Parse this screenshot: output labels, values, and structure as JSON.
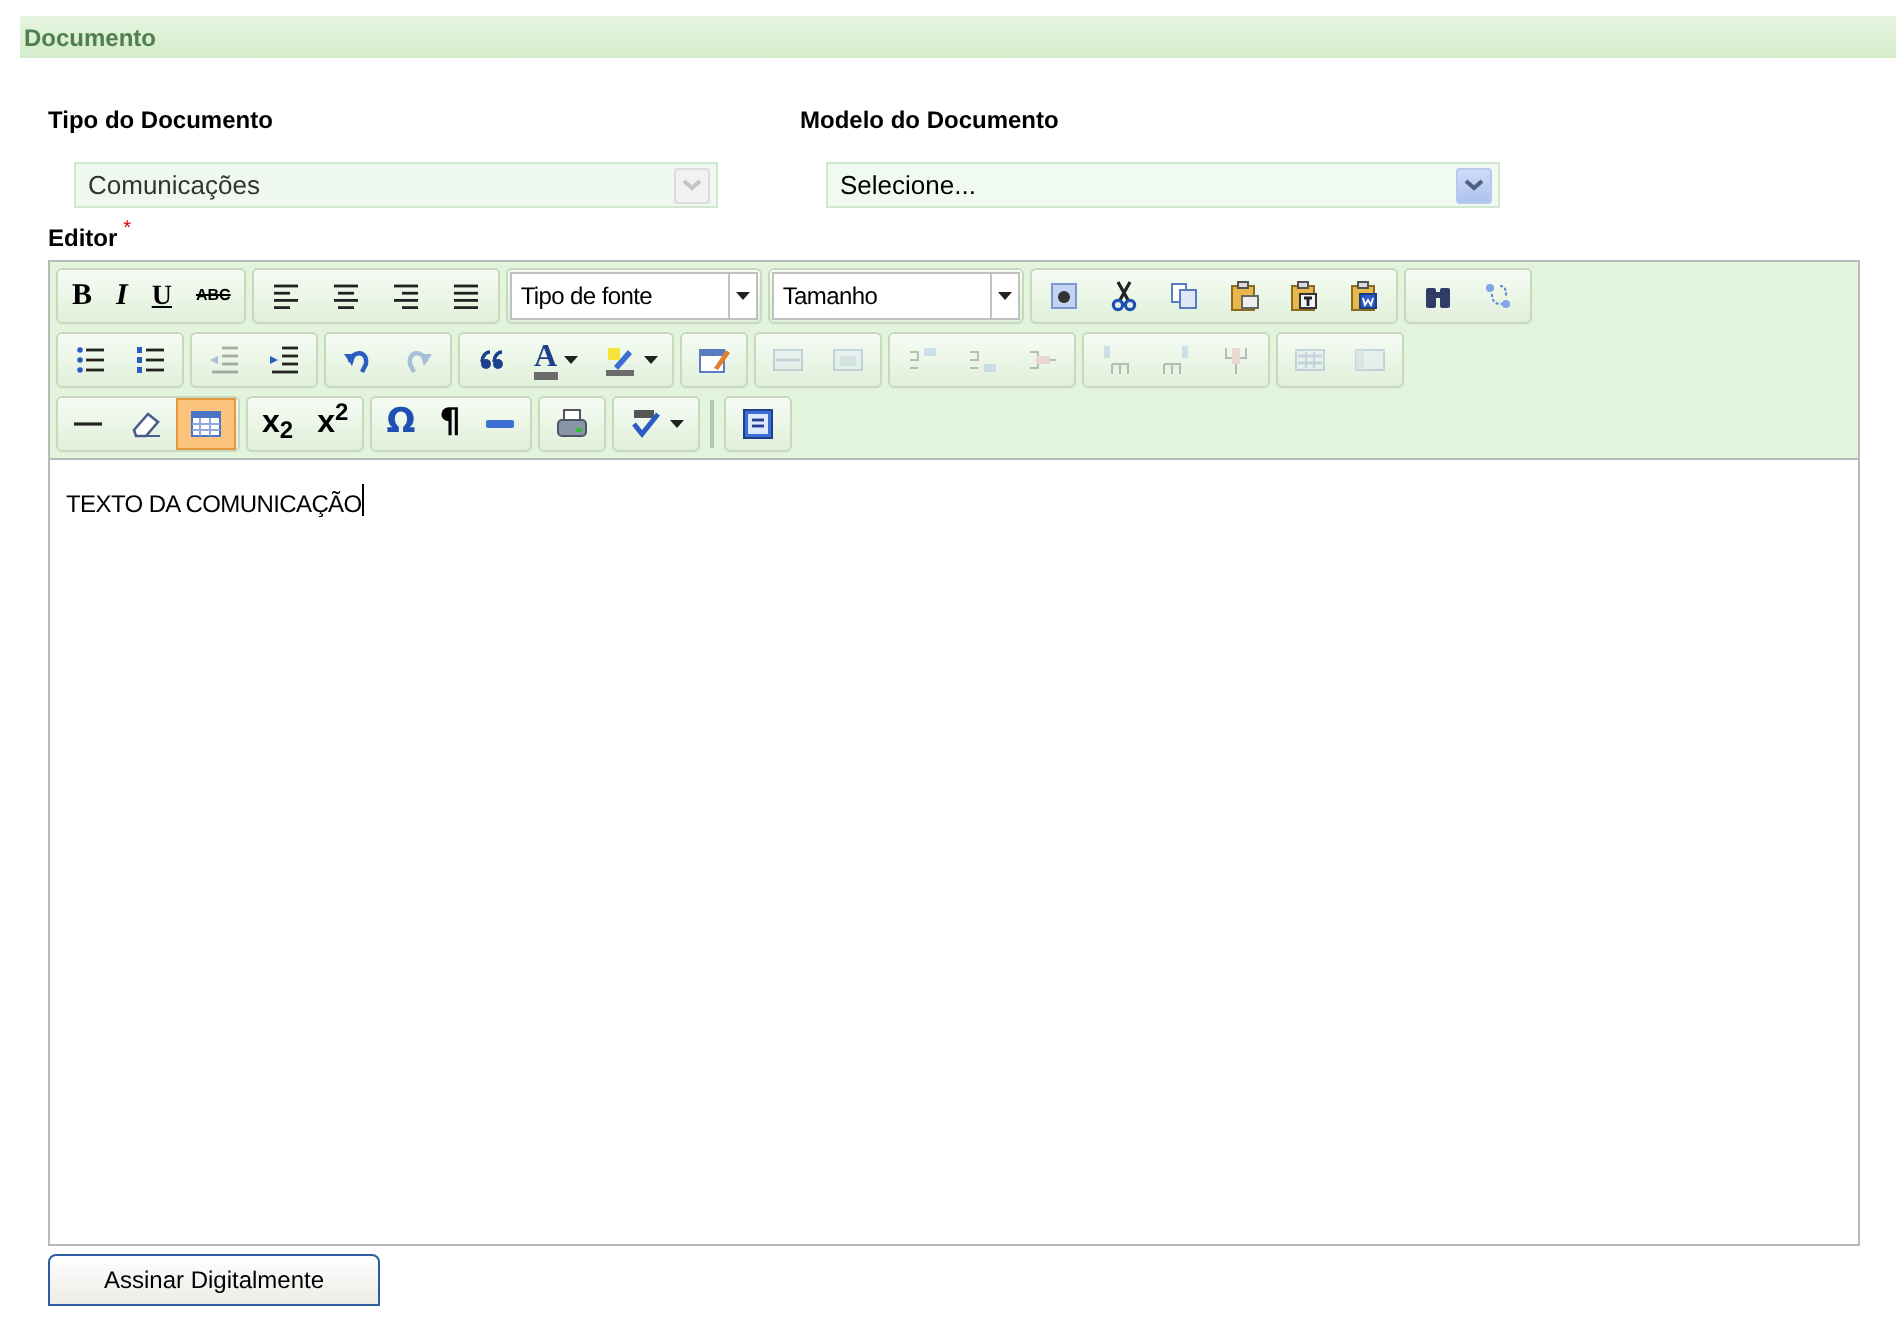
{
  "section": {
    "title": "Documento"
  },
  "fields": [
    {
      "label": "Tipo do Documento",
      "value": "Comunicações",
      "disabled": true
    },
    {
      "label": "Modelo do Documento",
      "value": "Selecione...",
      "disabled": false
    }
  ],
  "editor": {
    "label": "Editor",
    "required_mark": "*",
    "toolbar": [
      [
        [
          {
            "kind": "glyph",
            "label": "B",
            "disabled": false,
            "selected": false
          },
          {
            "kind": "glyph",
            "label": "I",
            "disabled": false,
            "selected": false
          },
          {
            "kind": "glyph",
            "label": "U",
            "disabled": false,
            "selected": false
          },
          {
            "kind": "glyph",
            "label": "ABC",
            "disabled": false,
            "selected": false
          }
        ],
        [
          {
            "kind": "icon",
            "disabled": false,
            "selected": false
          },
          {
            "kind": "icon",
            "disabled": false,
            "selected": false
          },
          {
            "kind": "icon",
            "disabled": false,
            "selected": false
          },
          {
            "kind": "icon",
            "disabled": false,
            "selected": false
          }
        ],
        [
          {
            "kind": "select",
            "label": "Tipo de fonte"
          }
        ],
        [
          {
            "kind": "select",
            "label": "Tamanho"
          }
        ],
        [
          {
            "kind": "icon",
            "disabled": false,
            "selected": false
          },
          {
            "kind": "icon",
            "disabled": false,
            "selected": false
          },
          {
            "kind": "icon",
            "disabled": false,
            "selected": false
          },
          {
            "kind": "icon",
            "disabled": false,
            "selected": false
          },
          {
            "kind": "icon",
            "disabled": false,
            "selected": false
          },
          {
            "kind": "icon",
            "disabled": false,
            "selected": false
          }
        ],
        [
          {
            "kind": "icon",
            "disabled": false,
            "selected": false
          },
          {
            "kind": "icon",
            "disabled": false,
            "selected": false
          }
        ]
      ],
      [
        [
          {
            "kind": "icon",
            "disabled": false,
            "selected": false
          },
          {
            "kind": "icon",
            "disabled": false,
            "selected": false
          }
        ],
        [
          {
            "kind": "icon",
            "disabled": true,
            "selected": false
          },
          {
            "kind": "icon",
            "disabled": false,
            "selected": false
          }
        ],
        [
          {
            "kind": "icon",
            "disabled": false,
            "selected": false
          },
          {
            "kind": "icon",
            "disabled": true,
            "selected": false
          }
        ],
        [
          {
            "kind": "icon",
            "disabled": false,
            "selected": false
          },
          {
            "kind": "glyph-split",
            "label": "A",
            "disabled": false,
            "selected": false
          },
          {
            "kind": "split",
            "disabled": false,
            "selected": false
          }
        ],
        [
          {
            "kind": "icon",
            "disabled": false,
            "selected": false
          }
        ],
        [
          {
            "kind": "icon",
            "disabled": true,
            "selected": false
          },
          {
            "kind": "icon",
            "disabled": true,
            "selected": false
          }
        ],
        [
          {
            "kind": "icon",
            "disabled": true,
            "selected": false
          },
          {
            "kind": "icon",
            "disabled": true,
            "selected": false
          },
          {
            "kind": "icon",
            "disabled": true,
            "selected": false
          }
        ],
        [
          {
            "kind": "icon",
            "disabled": true,
            "selected": false
          },
          {
            "kind": "icon",
            "disabled": true,
            "selected": false
          },
          {
            "kind": "icon",
            "disabled": true,
            "selected": false
          }
        ],
        [
          {
            "kind": "icon",
            "disabled": true,
            "selected": false
          },
          {
            "kind": "icon",
            "disabled": true,
            "selected": false
          }
        ]
      ],
      [
        [
          {
            "kind": "icon",
            "disabled": false,
            "selected": false
          },
          {
            "kind": "icon",
            "disabled": false,
            "selected": false
          },
          {
            "kind": "icon",
            "disabled": false,
            "selected": true
          }
        ],
        [
          {
            "kind": "glyph",
            "label": "x$_{2}$",
            "disabled": false,
            "selected": false
          },
          {
            "kind": "glyph",
            "label": "x$^{2}$",
            "disabled": false,
            "selected": false
          }
        ],
        [
          {
            "kind": "glyph",
            "label": "Ω",
            "disabled": false,
            "selected": false
          },
          {
            "kind": "glyph",
            "label": "¶",
            "disabled": false,
            "selected": false
          },
          {
            "kind": "icon",
            "disabled": false,
            "selected": false
          }
        ],
        [
          {
            "kind": "icon",
            "disabled": false,
            "selected": false
          }
        ],
        [
          {
            "kind": "split",
            "disabled": false,
            "selected": false
          }
        ],
        [
          {
            "kind": "icon",
            "disabled": false,
            "selected": false
          }
        ]
      ]
    ],
    "content": "TEXTO DA COMUNICAÇÃO"
  },
  "buttons": [
    {
      "label": "Assinar Digitalmente"
    }
  ]
}
